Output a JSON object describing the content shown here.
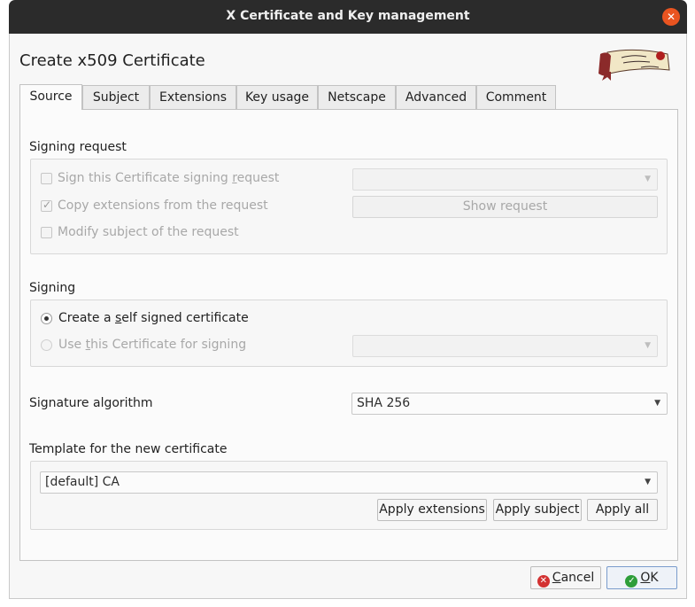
{
  "window": {
    "title": "X Certificate and Key management",
    "close_glyph": "✕"
  },
  "dialog": {
    "heading": "Create x509 Certificate",
    "logo_icon": "certificate-scroll-logo"
  },
  "tabs": [
    {
      "label": "Source",
      "active": true
    },
    {
      "label": "Subject"
    },
    {
      "label": "Extensions"
    },
    {
      "label": "Key usage"
    },
    {
      "label": "Netscape"
    },
    {
      "label": "Advanced"
    },
    {
      "label": "Comment"
    }
  ],
  "signing_request": {
    "title": "Signing request",
    "sign_csr": {
      "pre": "Sign this Certificate signing ",
      "ul": "r",
      "post": "equest",
      "checked": false,
      "enabled": false
    },
    "copy_ext": {
      "label": "Copy extensions from the request",
      "checked": true,
      "enabled": false
    },
    "modify_subject": {
      "label": "Modify subject of the request",
      "checked": false,
      "enabled": false
    },
    "request_combo": "",
    "show_request": "Show request"
  },
  "signing": {
    "title": "Signing",
    "self_signed": {
      "pre": "Create a ",
      "ul": "s",
      "post": "elf signed certificate",
      "selected": true
    },
    "use_cert": {
      "pre": "Use ",
      "ul": "t",
      "post": "his Certificate for signing",
      "selected": false
    },
    "cert_combo": ""
  },
  "signature": {
    "label": "Signature algorithm",
    "value": "SHA 256"
  },
  "template": {
    "title": "Template for the new certificate",
    "value": "[default] CA",
    "apply_extensions": "Apply extensions",
    "apply_subject": "Apply subject",
    "apply_all": "Apply all"
  },
  "footer": {
    "cancel": {
      "ul": "C",
      "post": "ancel"
    },
    "ok": {
      "ul": "O",
      "post": "K"
    }
  },
  "colors": {
    "titlebar": "#2b2b2b",
    "close": "#e95420",
    "ok_icon": "#2e9e3a",
    "cancel_icon": "#d33232"
  }
}
